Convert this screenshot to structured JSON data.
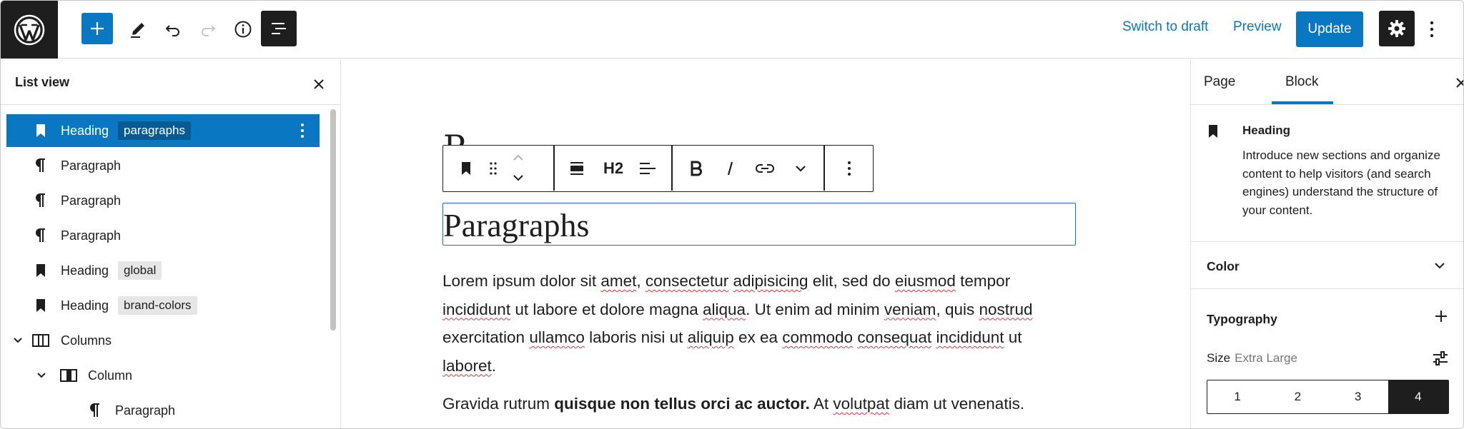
{
  "topbar": {
    "switch_to_draft": "Switch to draft",
    "preview": "Preview",
    "update": "Update"
  },
  "list_view": {
    "title": "List view",
    "rows": [
      {
        "label": "Heading",
        "badge": "paragraphs",
        "icon": "bookmark-icon",
        "selected": true
      },
      {
        "label": "Paragraph",
        "badge": "",
        "icon": "pilcrow-icon"
      },
      {
        "label": "Paragraph",
        "badge": "",
        "icon": "pilcrow-icon"
      },
      {
        "label": "Paragraph",
        "badge": "",
        "icon": "pilcrow-icon"
      },
      {
        "label": "Heading",
        "badge": "global",
        "icon": "bookmark-icon"
      },
      {
        "label": "Heading",
        "badge": "brand-colors",
        "icon": "bookmark-icon"
      },
      {
        "label": "Columns",
        "badge": "",
        "icon": "columns-icon"
      },
      {
        "label": "Column",
        "badge": "",
        "icon": "column-icon"
      },
      {
        "label": "Paragraph",
        "badge": "",
        "icon": "pilcrow-icon"
      }
    ]
  },
  "block_toolbar": {
    "heading_level": "H2"
  },
  "canvas": {
    "ghost_letter": "P",
    "heading": "Paragraphs",
    "para1": [
      "Lorem ipsum dolor sit ",
      "amet",
      ", ",
      "consectetur",
      " ",
      "adipisicing",
      " elit, sed do ",
      "eiusmod",
      " tempor ",
      "incididunt",
      " ut labore et dolore magna ",
      "aliqua",
      ". Ut enim ad minim ",
      "veniam",
      ", quis ",
      "nostrud",
      " exercitation ",
      "ullamco",
      " laboris nisi ut ",
      "aliquip",
      " ex ea ",
      "commodo",
      " ",
      "consequat",
      " ",
      "incididunt",
      " ut ",
      "laboret",
      "."
    ],
    "para2_start": "Gravida rutrum ",
    "para2_bold": "quisque non tellus orci ac auctor.",
    "para2_mid": " At ",
    "para2_sp": "volutpat",
    "para2_end": " diam ut venenatis."
  },
  "inspector": {
    "tab_page": "Page",
    "tab_block": "Block",
    "block_title": "Heading",
    "block_desc": "Introduce new sections and organize content to help visitors (and search engines) understand the structure of your content.",
    "color_title": "Color",
    "typography_title": "Typography",
    "size_label": "Size",
    "size_value": "Extra Large",
    "sizes": [
      "1",
      "2",
      "3",
      "4"
    ],
    "active_size": "4"
  },
  "colors": {
    "accent": "#0a77c2",
    "dark": "#1e1e1e"
  }
}
